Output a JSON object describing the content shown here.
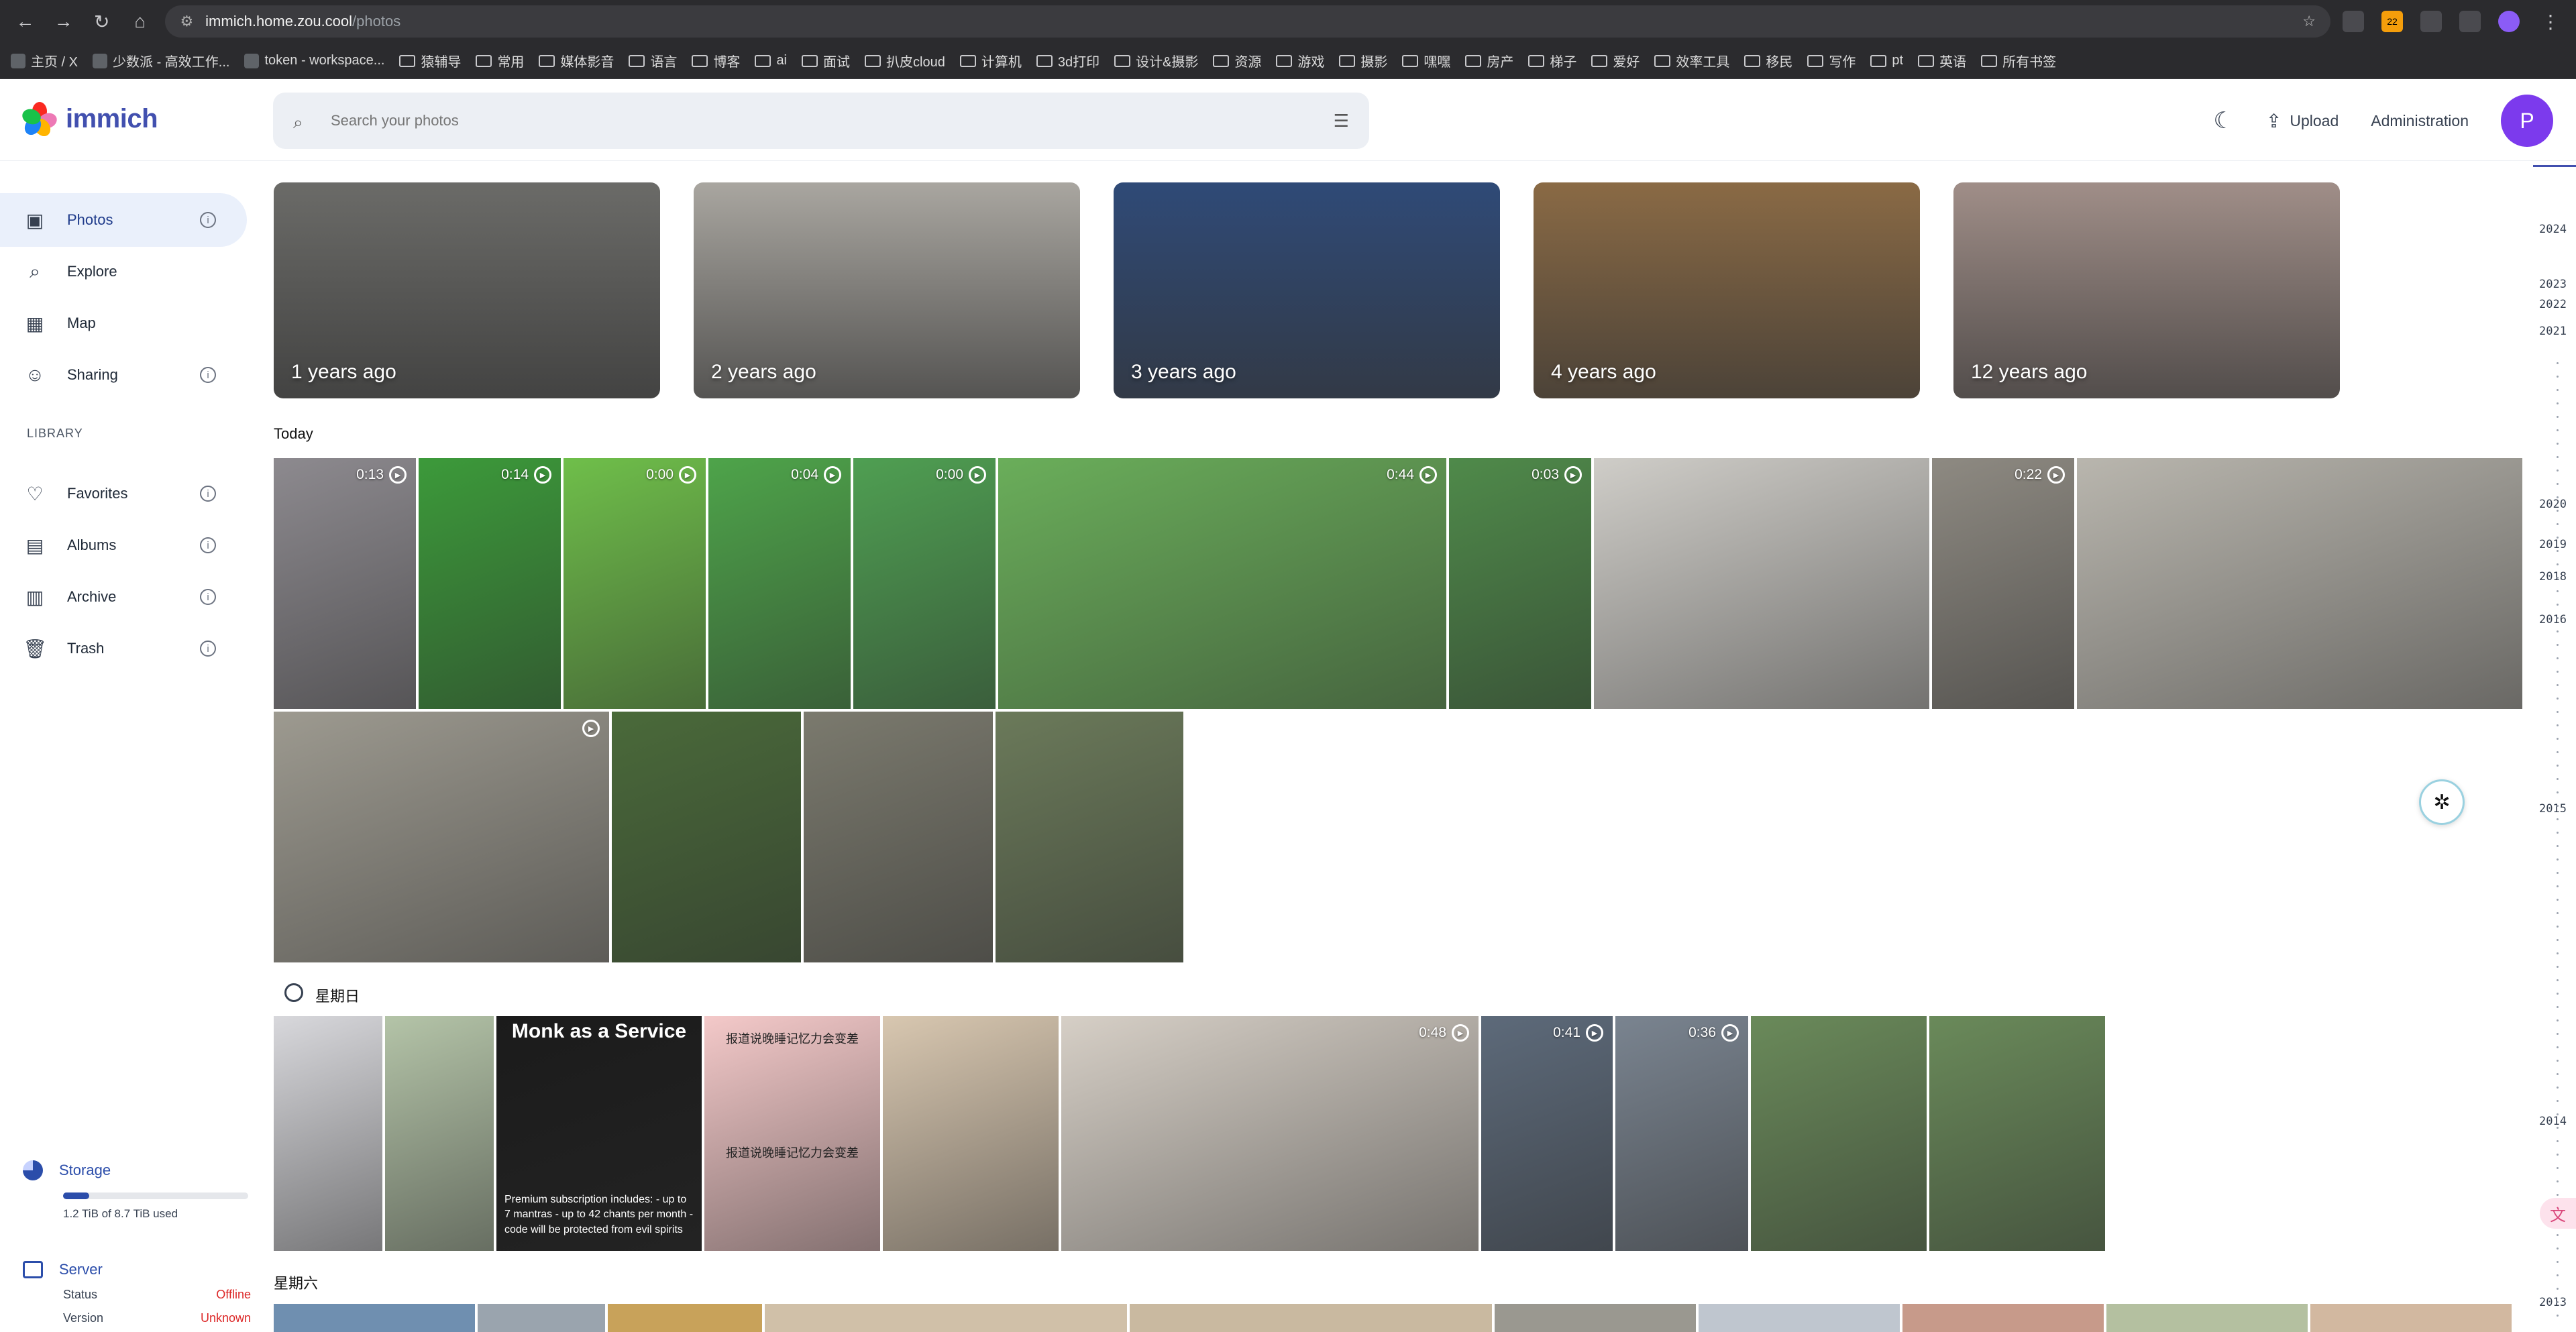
{
  "browser": {
    "url_host": "immich.home.zou.cool",
    "url_path": "/photos",
    "bookmarks": [
      "主页 / X",
      "少数派 - 高效工作...",
      "token - workspace...",
      "猿辅导",
      "常用",
      "媒体影音",
      "语言",
      "博客",
      "ai",
      "面试",
      "扒皮cloud",
      "计算机",
      "3d打印",
      "设计&摄影",
      "资源",
      "游戏",
      "摄影",
      "嘿嘿",
      "房产",
      "梯子",
      "爱好",
      "效率工具",
      "移民",
      "写作",
      "pt",
      "英语",
      "所有书签"
    ],
    "extension_badge": "22"
  },
  "app": {
    "name": "immich",
    "search_placeholder": "Search your photos",
    "upload_label": "Upload",
    "admin_label": "Administration",
    "avatar_letter": "P"
  },
  "sidebar": {
    "items": [
      {
        "label": "Photos",
        "icon": "photos-icon",
        "active": true,
        "info": true
      },
      {
        "label": "Explore",
        "icon": "explore-icon",
        "active": false,
        "info": false
      },
      {
        "label": "Map",
        "icon": "map-icon",
        "active": false,
        "info": false
      },
      {
        "label": "Sharing",
        "icon": "sharing-icon",
        "active": false,
        "info": true
      }
    ],
    "library_label": "LIBRARY",
    "library_items": [
      {
        "label": "Favorites",
        "icon": "heart-icon"
      },
      {
        "label": "Albums",
        "icon": "albums-icon"
      },
      {
        "label": "Archive",
        "icon": "archive-icon"
      },
      {
        "label": "Trash",
        "icon": "trash-icon"
      }
    ],
    "storage": {
      "title": "Storage",
      "used_text": "1.2 TiB of 8.7 TiB used",
      "used_fraction": 0.14
    },
    "server": {
      "title": "Server",
      "status_label": "Status",
      "status_value": "Offline",
      "version_label": "Version",
      "version_value": "Unknown"
    }
  },
  "memories": [
    {
      "label": "1 years ago",
      "color": "#6b6b68"
    },
    {
      "label": "2 years ago",
      "color": "#a9a6a0"
    },
    {
      "label": "3 years ago",
      "color": "#2f4a77"
    },
    {
      "label": "4 years ago",
      "color": "#8a6a45"
    },
    {
      "label": "12 years ago",
      "color": "#a08e88"
    }
  ],
  "sections": [
    {
      "title": "Today",
      "rows": [
        [
          {
            "color": "#8d8a8f",
            "duration": "0:13"
          },
          {
            "color": "#3c9a3a",
            "duration": "0:14"
          },
          {
            "color": "#6fbf4a",
            "duration": "0:00"
          },
          {
            "color": "#4ea44a",
            "duration": "0:04"
          },
          {
            "color": "#4f9f52",
            "duration": "0:00"
          },
          {
            "color": "#6aae5a",
            "duration": "0:44"
          },
          {
            "color": "#4f8a4a",
            "duration": "0:03"
          },
          {
            "color": "#cfcdc8",
            "duration": ""
          },
          {
            "color": "#8e8a82",
            "duration": "0:22"
          },
          {
            "color": "#b9b6ae",
            "duration": ""
          }
        ],
        [
          {
            "color": "#9d9a90",
            "duration": "",
            "play_only": true
          },
          {
            "color": "#4a6a3a",
            "duration": ""
          },
          {
            "color": "#7b7a6e",
            "duration": ""
          },
          {
            "color": "#6b7a5a",
            "duration": ""
          }
        ]
      ]
    },
    {
      "title": "星期日",
      "rows": [
        [
          {
            "color": "#d8d8dc",
            "duration": ""
          },
          {
            "color": "#b4c4a8",
            "duration": ""
          },
          {
            "color": "#1b1b1b",
            "duration": "",
            "caption": "Monk as a Service",
            "subtext": "Premium subscription includes: - up to 7 mantras - up to 42 chants per month - code will be protected from evil spirits"
          },
          {
            "color": "#f4c9c9",
            "duration": "",
            "sticker": "报道说晚睡记忆力会变差"
          },
          {
            "color": "#d8c7b0",
            "duration": ""
          },
          {
            "color": "#d6cfc6",
            "duration": "0:48"
          },
          {
            "color": "#5d6a7a",
            "duration": "0:41"
          },
          {
            "color": "#7a8490",
            "duration": "0:36"
          },
          {
            "color": "#6a8a5a",
            "duration": ""
          },
          {
            "color": "#6a8a5a",
            "duration": ""
          }
        ]
      ]
    },
    {
      "title": "星期六",
      "rows": []
    }
  ],
  "scrubber_years": [
    "2024",
    "2023",
    "2022",
    "2021",
    "2020",
    "2019",
    "2018",
    "2016",
    "2015",
    "2014",
    "2013"
  ]
}
